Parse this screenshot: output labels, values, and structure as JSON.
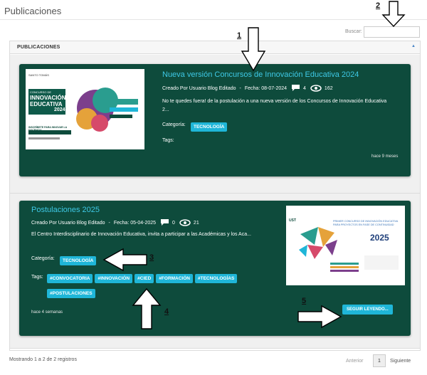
{
  "page": {
    "title": "Publicaciones"
  },
  "search": {
    "label": "Buscar:",
    "value": ""
  },
  "panel": {
    "title": "PUBLICACIONES"
  },
  "posts": [
    {
      "title": "Nueva versión Concursos de Innovación Educativa 2024",
      "author": "Creado Por  Usuario Blog Editado",
      "date": "Fecha: 08-07-2024",
      "comments": "4",
      "views": "162",
      "description": "No te quedes fuera! de la postulación a una nueva versión de los Concursos de Innovación Educativa 2...",
      "category_label": "Categoría:",
      "category": "TECNOLOGÍA",
      "tags_label": "Tags:",
      "tags": [],
      "ago": "hace 9 meses",
      "thumb": {
        "brand": "SANTO TOMÁS",
        "heading_1": "CONCURSO DE",
        "heading_2": "INNOVACIÓN",
        "heading_3": "EDUCATIVA",
        "year": "2024",
        "cta": "INSCRÍBETE PARA INNOVAR LA DOCENCIA"
      }
    },
    {
      "title": "Postulaciones 2025",
      "author": "Creado Por  Usuario Blog Editado",
      "date": "Fecha: 05-04-2025",
      "comments": "0",
      "views": "21",
      "description": "El Centro Interdisciplinario de Innovación Educativa, invita a participar a las Académicas y los Aca...",
      "category_label": "Categoría:",
      "category": "TECNOLOGÍA",
      "tags_label": "Tags:",
      "tags": [
        "#CONVOCATORIA",
        "#INNOVACIÓN",
        "#CIED",
        "#FORMACIÓN",
        "#TECNOLOGÍAS",
        "#POSTULACIONES"
      ],
      "ago": "hace 4 semanas",
      "read_more": "SEGUIR LEYENDO...",
      "thumb": {
        "brand": "UST",
        "heading": "PRIMER CONCURSO DE INNOVACIÓN EDUCATIVA PARA PROYECTOS EN FASE DE CONTINUIDAD",
        "year": "2025"
      }
    }
  ],
  "footer": {
    "info": "Mostrando 1 a 2 de 2 registros",
    "prev": "Anterior",
    "page": "1",
    "next": "Siguiente"
  },
  "annotations": [
    "1",
    "2",
    "3",
    "4",
    "5"
  ],
  "colors": {
    "card_bg": "#0e4b3c",
    "accent": "#1fb6d8",
    "title": "#3ec9e6"
  }
}
